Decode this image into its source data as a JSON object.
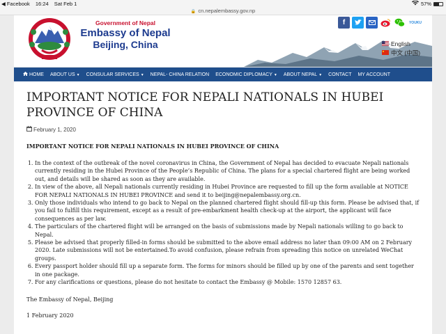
{
  "status_bar": {
    "back_app": "◀ Facebook",
    "time": "16:24",
    "date": "Sat Feb 1",
    "battery": "57%",
    "battery_level": 0.57
  },
  "url_bar": {
    "url": "cn.nepalembassy.gov.np"
  },
  "header": {
    "government": "Government of Nepal",
    "embassy": "Embassy of Nepal",
    "city": "Beijing, China",
    "social_icons": [
      "facebook-icon",
      "twitter-icon",
      "email-icon",
      "weibo-icon",
      "wechat-icon",
      "youku-icon"
    ],
    "languages": [
      {
        "label": "English"
      },
      {
        "label": "中文 (中国)"
      }
    ]
  },
  "nav": {
    "items": [
      {
        "label": "HOME",
        "icon": "home-icon"
      },
      {
        "label": "ABOUT US",
        "dropdown": true
      },
      {
        "label": "CONSULAR SERVICES",
        "dropdown": true
      },
      {
        "label": "NEPAL- CHINA RELATION"
      },
      {
        "label": "ECONOMIC DIPLOMACY",
        "dropdown": true
      },
      {
        "label": "ABOUT NEPAL",
        "dropdown": true
      },
      {
        "label": "CONTACT"
      },
      {
        "label": "MY ACCOUNT"
      }
    ]
  },
  "article": {
    "title": "IMPORTANT NOTICE FOR NEPALI NATIONALS IN HUBEI PROVINCE OF CHINA",
    "date": "February 1, 2020",
    "subheading": "IMPORTANT NOTICE FOR NEPALI NATIONALS IN HUBEI PROVINCE OF CHINA",
    "items": [
      "In the context of the outbreak of the novel coronavirus in China, the Government of Nepal has decided to evacuate Nepali nationals currently residing in the Hubei Province of the People’s Republic of China. The plans for a special chartered flight are being worked out, and details will be shared as soon as they are available.",
      "In view of the above, all Nepali nationals currently residing in Hubei Province are requested to fill up the form available at NOTICE FOR NEPALI NATIONALS IN HUBEI PROVINCE and send it to beijing@nepalembassy.org.cn.",
      "Only those individuals who intend to go back to Nepal on the planned chartered flight should fill-up this form. Please be advised that, if you fail to fulfill this requirement, except as a result of pre-embarkment health check-up at the airport, the applicant will face consequences as per law.",
      "The particulars of the chartered flight will be arranged on the basis of submissions made by Nepali nationals willing to go back to Nepal.",
      "Please be advised that properly filled-in forms should be submitted to the above email address no later than 09:00 AM on 2 February 2020. Late submissions will not be entertained.To avoid confusion, please refrain from spreading this notice on unrelated WeChat groups.",
      "Every passport holder should fill up a separate form. The forms for minors should be filled up by one of the parents and sent together in one package.",
      "For any clarifications or questions, please do not hesitate to contact the Embassy @ Mobile: 1570 12857 63."
    ],
    "signature": "The Embassy of Nepal, Beijing",
    "sign_date": "1 February 2020"
  }
}
